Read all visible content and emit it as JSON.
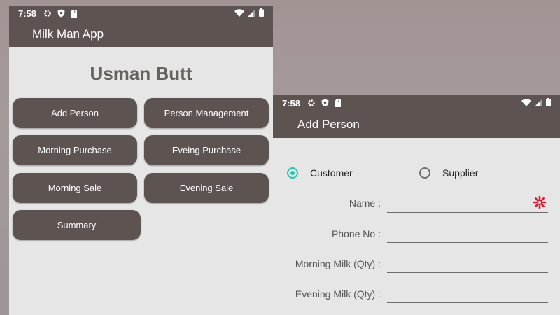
{
  "status_bar": {
    "time": "7:58",
    "icons": [
      "gear-icon",
      "shield-icon",
      "sd-card-icon"
    ],
    "right_icons": [
      "wifi-icon",
      "signal-icon",
      "battery-icon"
    ]
  },
  "home_screen": {
    "app_title": "Milk Man App",
    "user_name": "Usman Butt",
    "buttons": [
      {
        "label": "Add Person"
      },
      {
        "label": "Person Management"
      },
      {
        "label": "Morning Purchase"
      },
      {
        "label": "Eveing Purchase"
      },
      {
        "label": "Morning Sale"
      },
      {
        "label": "Evening Sale"
      },
      {
        "label": "Summary"
      }
    ]
  },
  "add_person_screen": {
    "app_title": "Add Person",
    "radio_options": [
      {
        "label": "Customer",
        "checked": true
      },
      {
        "label": "Supplier",
        "checked": false
      }
    ],
    "fields": [
      {
        "label": "Name :",
        "value": "",
        "required": true
      },
      {
        "label": "Phone No :",
        "value": ""
      },
      {
        "label": "Morning Milk (Qty) :",
        "value": ""
      },
      {
        "label": "Evening Milk (Qty) :",
        "value": ""
      }
    ]
  },
  "colors": {
    "primary": "#5d5351",
    "accent": "#1fc6b3",
    "required": "#e21b2c",
    "background": "#e6e6e6"
  }
}
